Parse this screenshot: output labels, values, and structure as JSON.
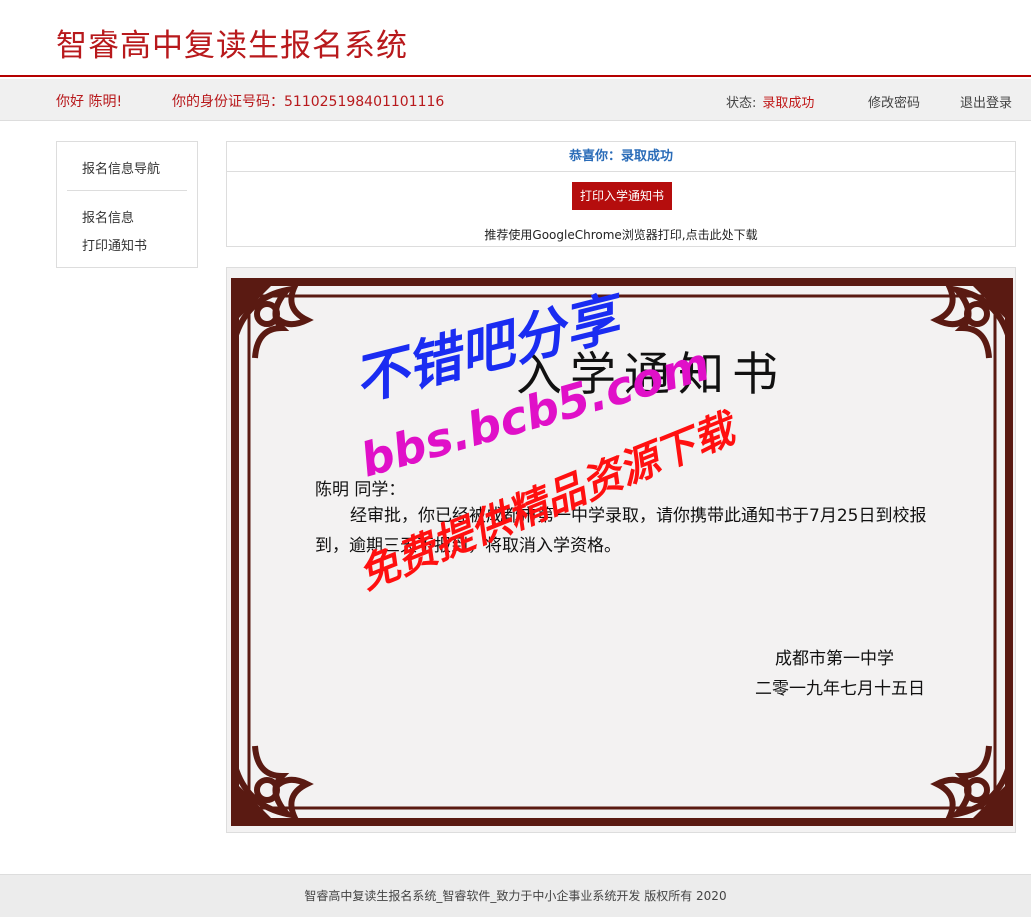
{
  "header": {
    "title": "智睿高中复读生报名系统"
  },
  "userbar": {
    "greeting": "你好 陈明!",
    "id_label": "你的身份证号码：511025198401101116",
    "status_label": "状态:",
    "status_value": "录取成功",
    "change_password": "修改密码",
    "logout": "退出登录"
  },
  "sidebar": {
    "title": "报名信息导航",
    "items": [
      {
        "label": "报名信息"
      },
      {
        "label": "打印通知书"
      }
    ]
  },
  "panel": {
    "congrats": "恭喜你：录取成功",
    "print_button": "打印入学通知书",
    "hint": "推荐使用GoogleChrome浏览器打印,点击此处下载"
  },
  "certificate": {
    "title": "入学通知书",
    "student": "陈明 同学：",
    "body": "经审批，你已经被成都市第一中学录取，请你携带此通知书于7月25日到校报到，逾期三天不报到，将取消入学资格。",
    "school": "成都市第一中学",
    "date": "二零一九年七月十五日"
  },
  "watermark": {
    "line1": "不错吧分享",
    "line2": "bbs.bcb5.com",
    "line3": "免费提供精品资源下载"
  },
  "footer": {
    "text": "智睿高中复读生报名系统_智睿软件_致力于中小企事业系统开发  版权所有   2020"
  },
  "colors": {
    "brand": "#b8191c",
    "button": "#b50d0d",
    "link_blue": "#2a6cb8",
    "frame": "#5a1a12"
  }
}
